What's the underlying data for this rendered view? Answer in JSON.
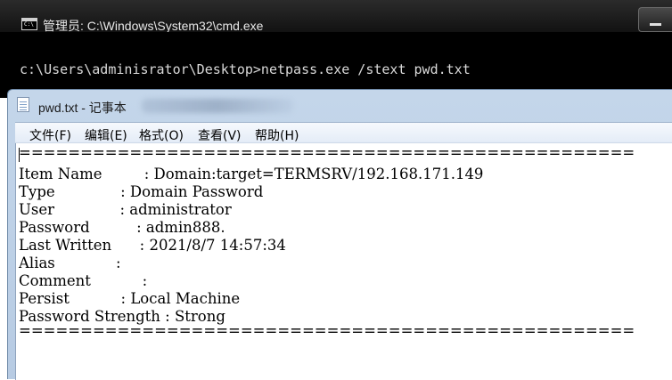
{
  "cmd": {
    "title": "管理员: C:\\Windows\\System32\\cmd.exe",
    "icon_text": "C:\\",
    "line": "c:\\Users\\adminisrator\\Desktop>netpass.exe /stext pwd.txt"
  },
  "notepad": {
    "title": "pwd.txt - 记事本",
    "menu": [
      {
        "label": "文件(F)"
      },
      {
        "label": "编辑(E)"
      },
      {
        "label": "格式(O)"
      },
      {
        "label": "查看(V)"
      },
      {
        "label": "帮助(H)"
      }
    ],
    "lines": [
      "==================================================",
      "Item Name         : Domain:target=TERMSRV/192.168.171.149",
      "Type              : Domain Password",
      "User              : administrator",
      "Password          : admin888.",
      "Last Written      : 2021/8/7 14:57:34",
      "Alias             :",
      "Comment           :",
      "Persist           : Local Machine",
      "Password Strength : Strong",
      "=================================================="
    ]
  }
}
